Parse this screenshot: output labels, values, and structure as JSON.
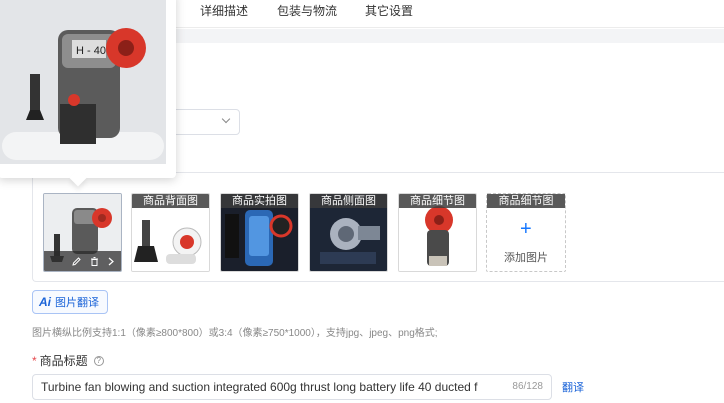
{
  "tabs": [
    {
      "label": "详细描述"
    },
    {
      "label": "包装与物流"
    },
    {
      "label": "其它设置"
    }
  ],
  "gallery": {
    "images": [
      {
        "caption": "",
        "product": "blower-h40"
      },
      {
        "caption": "商品背面图",
        "product": "blower-parts"
      },
      {
        "caption": "商品实拍图",
        "product": "blower-xray"
      },
      {
        "caption": "商品侧面图",
        "product": "blower-motor"
      },
      {
        "caption": "商品细节图",
        "product": "blower-red"
      }
    ],
    "add_tile": {
      "caption": "商品细节图",
      "label": "添加图片",
      "icon": "plus-icon"
    }
  },
  "ai_button": {
    "badge": "Ai",
    "label": "图片翻译"
  },
  "hint": "图片横纵比例支持1:1（像素≥800*800）或3:4（像素≥750*1000），支持jpg、jpeg、png格式;",
  "title_field": {
    "label": "商品标题",
    "value": "Turbine fan blowing and suction integrated 600g thrust long battery life 40 ducted f",
    "count": "86/128",
    "translate_label": "翻译"
  },
  "colors": {
    "accent": "#1a63d8",
    "required": "#e5484d",
    "product_red": "#d8372a"
  }
}
